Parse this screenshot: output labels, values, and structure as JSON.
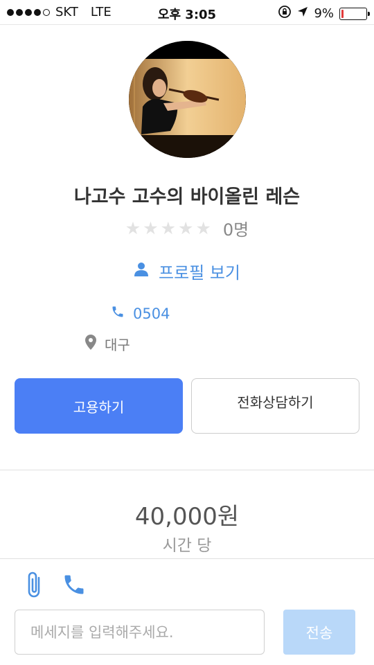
{
  "status_bar": {
    "carrier": "SKT",
    "network": "LTE",
    "time": "오후 3:05",
    "battery_text": "9%",
    "battery_level": 0.09
  },
  "profile": {
    "title": "나고수 고수의 바이올린 레슨",
    "rating_count": "0명",
    "view_profile_label": "프로필 보기",
    "phone": "0504",
    "location": "대구"
  },
  "actions": {
    "hire_label": "고용하기",
    "call_label": "전화상담하기"
  },
  "pricing": {
    "price": "40,000원",
    "unit": "시간 당"
  },
  "composer": {
    "placeholder": "메세지를 입력해주세요.",
    "send_label": "전송"
  },
  "colors": {
    "accent": "#4b7ff5",
    "link": "#4a90e2",
    "send_disabled": "#b9d8f9"
  },
  "icons": [
    "person-icon",
    "phone-icon",
    "location-pin-icon",
    "paperclip-icon",
    "call-icon",
    "star-icon"
  ]
}
